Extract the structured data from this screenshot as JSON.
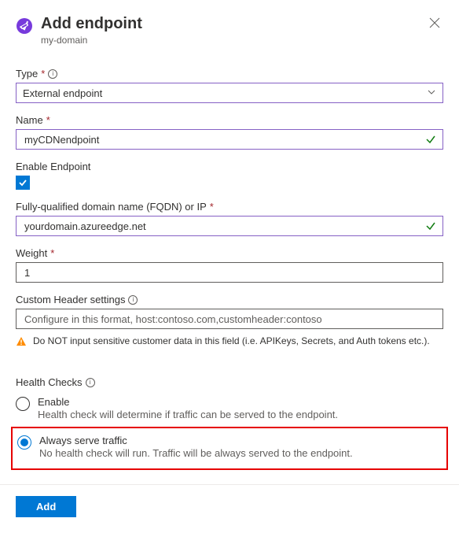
{
  "header": {
    "title": "Add endpoint",
    "subtitle": "my-domain"
  },
  "fields": {
    "type": {
      "label": "Type",
      "value": "External endpoint"
    },
    "name": {
      "label": "Name",
      "value": "myCDNendpoint"
    },
    "enable": {
      "label": "Enable Endpoint",
      "checked": true
    },
    "fqdn": {
      "label": "Fully-qualified domain name (FQDN) or IP",
      "value": "yourdomain.azureedge.net"
    },
    "weight": {
      "label": "Weight",
      "value": "1"
    },
    "customHeader": {
      "label": "Custom Header settings",
      "placeholder": "Configure in this format, host:contoso.com,customheader:contoso"
    }
  },
  "warning": "Do NOT input sensitive customer data in this field (i.e. APIKeys, Secrets, and Auth tokens etc.).",
  "healthChecks": {
    "label": "Health Checks",
    "options": {
      "enable": {
        "label": "Enable",
        "desc": "Health check will determine if traffic can be served to the endpoint."
      },
      "always": {
        "label": "Always serve traffic",
        "desc": "No health check will run. Traffic will be always served to the endpoint."
      }
    }
  },
  "footer": {
    "add": "Add"
  }
}
